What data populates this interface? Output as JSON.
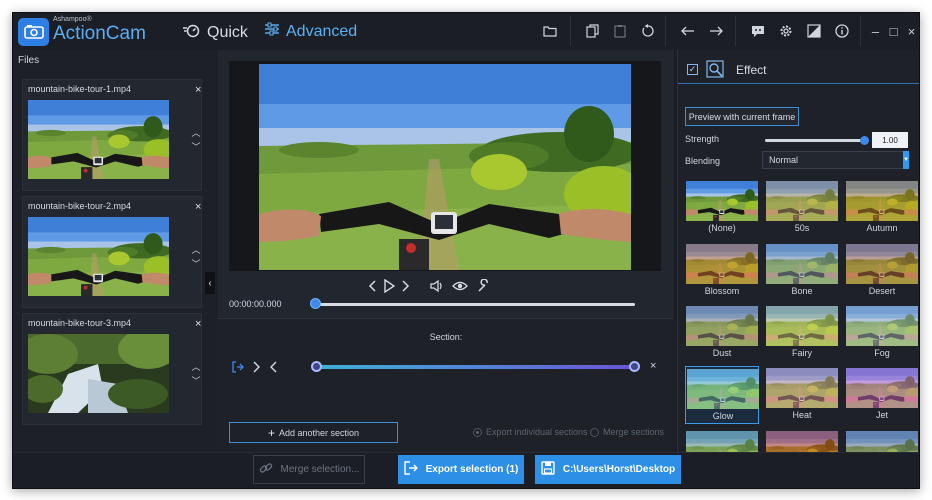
{
  "app": {
    "vendor": "Ashampoo®",
    "name": "ActionCam",
    "modes": [
      {
        "label": "Quick",
        "icon": "stopwatch-icon"
      },
      {
        "label": "Advanced",
        "icon": "sliders-icon"
      }
    ],
    "toolbar_icons": [
      "folder-open-icon",
      "copy-icon",
      "paste-icon",
      "reset-icon",
      "undo-icon",
      "redo-icon",
      "feedback-icon",
      "gear-icon",
      "compare-icon",
      "info-icon"
    ],
    "window_controls": {
      "minimize": "–",
      "maximize": "□",
      "close": "×"
    }
  },
  "files": {
    "title": "Files",
    "items": [
      {
        "name": "mountain-bike-tour-1.mp4",
        "close": "×",
        "up": "︿",
        "down": "﹀"
      },
      {
        "name": "mountain-bike-tour-2.mp4",
        "close": "×",
        "up": "︿",
        "down": "﹀"
      },
      {
        "name": "mountain-bike-tour-3.mp4",
        "close": "×",
        "up": "︿",
        "down": "﹀"
      }
    ],
    "collapse_glyph": "‹"
  },
  "player": {
    "timecode": "00:00:00.000",
    "position": 0.0,
    "controls": [
      "prev-frame-icon",
      "play-icon",
      "next-frame-icon",
      "volume-icon",
      "eye-icon",
      "wrench-icon"
    ]
  },
  "section": {
    "label": "Section:",
    "start": 0.0,
    "end": 1.0,
    "remove": "×",
    "add_label": "Add another section",
    "add_glyph": "+",
    "options": [
      {
        "label": "Export individual sections",
        "selected": true
      },
      {
        "label": "Merge sections",
        "selected": false
      }
    ]
  },
  "effect": {
    "title": "Effect",
    "enabled": true,
    "check_glyph": "✓",
    "preview_button": "Preview with current frame",
    "strength_label": "Strength",
    "strength_value": "1.00",
    "strength_level": 1.0,
    "blending_label": "Blending",
    "blending_value": "Normal",
    "presets": [
      {
        "name": "(None)",
        "tint": "none"
      },
      {
        "name": "50s",
        "tint": "#c9a46a"
      },
      {
        "name": "Autumn",
        "tint": "#d8901e"
      },
      {
        "name": "Blossom",
        "tint": "#e0762a"
      },
      {
        "name": "Bone",
        "tint": "#9aa7b4"
      },
      {
        "name": "Desert",
        "tint": "#c9703a"
      },
      {
        "name": "Dust",
        "tint": "#a89a86"
      },
      {
        "name": "Fairy",
        "tint": "#dcd47a"
      },
      {
        "name": "Fog",
        "tint": "#b8c7c9"
      },
      {
        "name": "Glow",
        "tint": "#7fd0c8"
      },
      {
        "name": "Heat",
        "tint": "#e8a0a0"
      },
      {
        "name": "Jet",
        "tint": "#e06ad0"
      },
      {
        "name": "",
        "tint": "#8ab07a"
      },
      {
        "name": "",
        "tint": "#e83a10"
      },
      {
        "name": "",
        "tint": "#8a8a8a"
      }
    ],
    "selected_preset": "Glow"
  },
  "bottom": {
    "merge_label": "Merge selection...",
    "export_label": "Export selection (1)",
    "path_label": "C:\\Users\\Horst\\Desktop"
  },
  "colors": {
    "accent": "#2d8fe6",
    "brand": "#5aaef5",
    "background": "#1b1e25"
  }
}
